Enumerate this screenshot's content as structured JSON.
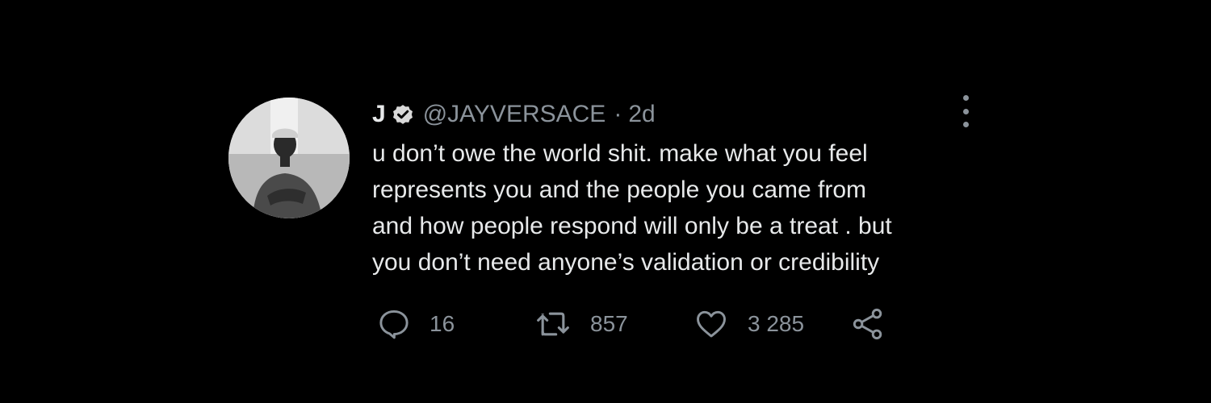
{
  "tweet": {
    "display_name": "J",
    "handle": "@JAYVERSACE",
    "separator": "·",
    "time": "2d",
    "text_lines": [
      "u don’t owe the world shit. make what you feel",
      "represents you and the people you came from",
      "and how people respond will only be a treat . but",
      "you don’t need anyone’s validation or credibility"
    ],
    "icons": {
      "verified": "verified-badge-icon",
      "more": "more-vertical-icon",
      "reply": "reply-icon",
      "retweet": "retweet-icon",
      "like": "heart-icon",
      "share": "share-icon"
    },
    "actions": {
      "replies": "16",
      "retweets": "857",
      "likes": "3 285"
    }
  },
  "colors": {
    "background": "#000000",
    "primary_text": "#e7e9ea",
    "secondary_text": "#8b939b"
  }
}
